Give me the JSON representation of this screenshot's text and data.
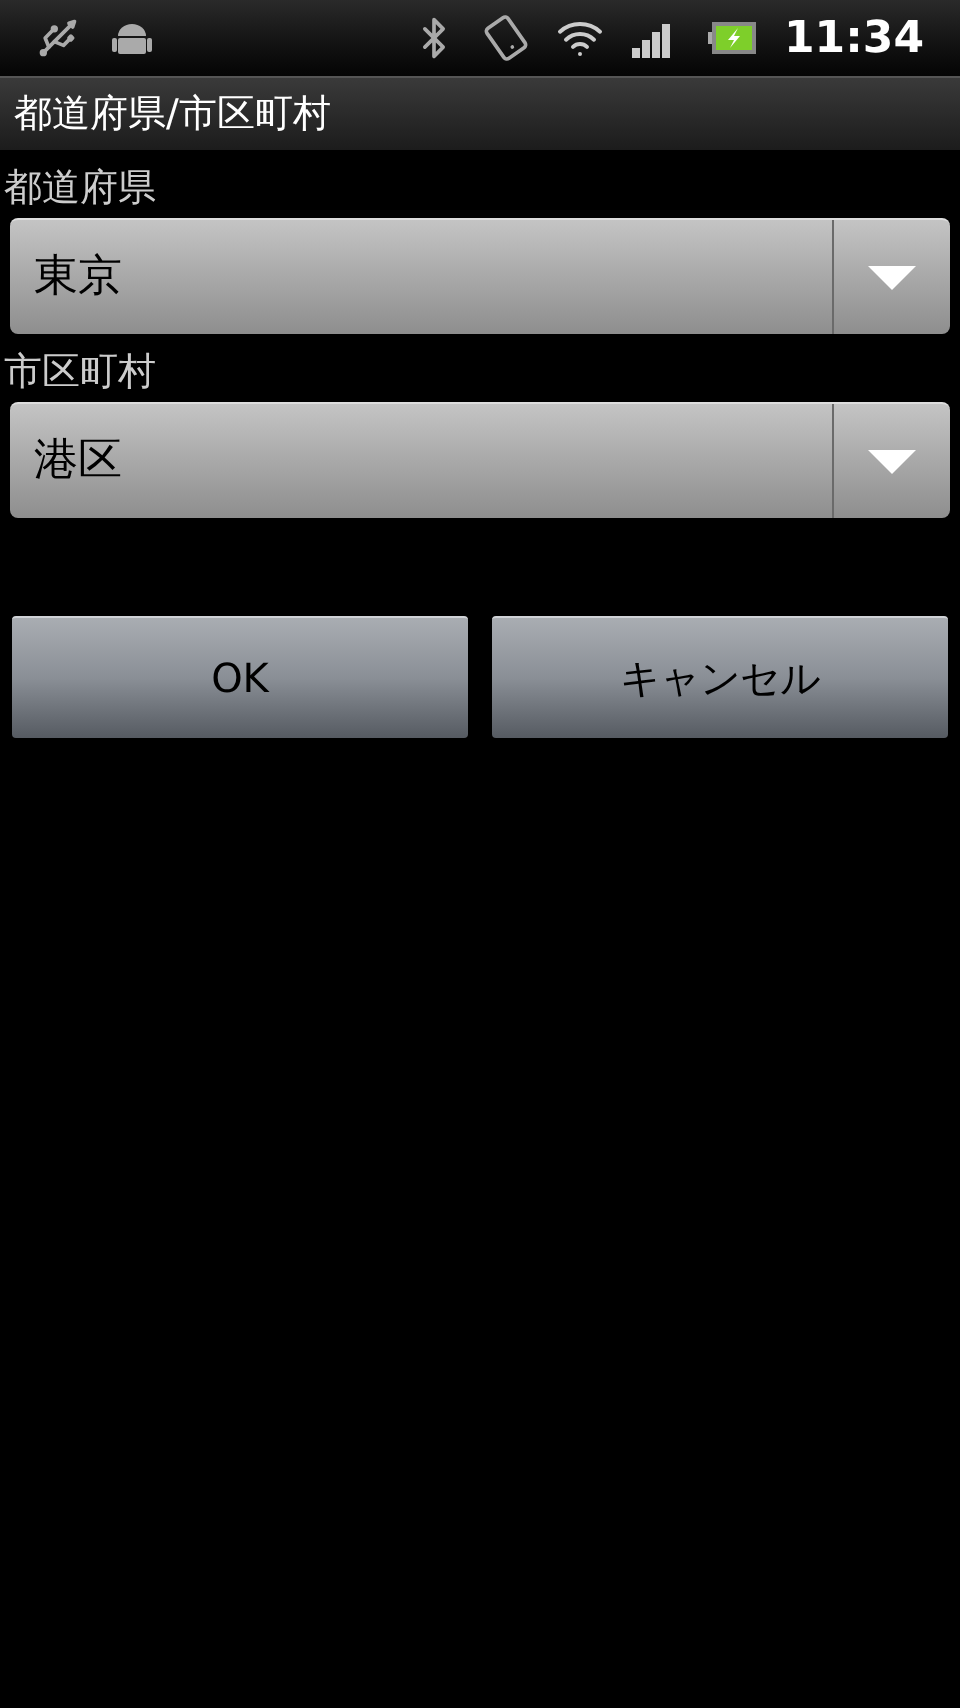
{
  "status_bar": {
    "time": "11:34"
  },
  "title_bar": {
    "title": "都道府県/市区町村"
  },
  "fields": [
    {
      "label": "都道府県",
      "value": "東京"
    },
    {
      "label": "市区町村",
      "value": "港区"
    }
  ],
  "buttons": [
    "OK",
    "キャンセル"
  ]
}
